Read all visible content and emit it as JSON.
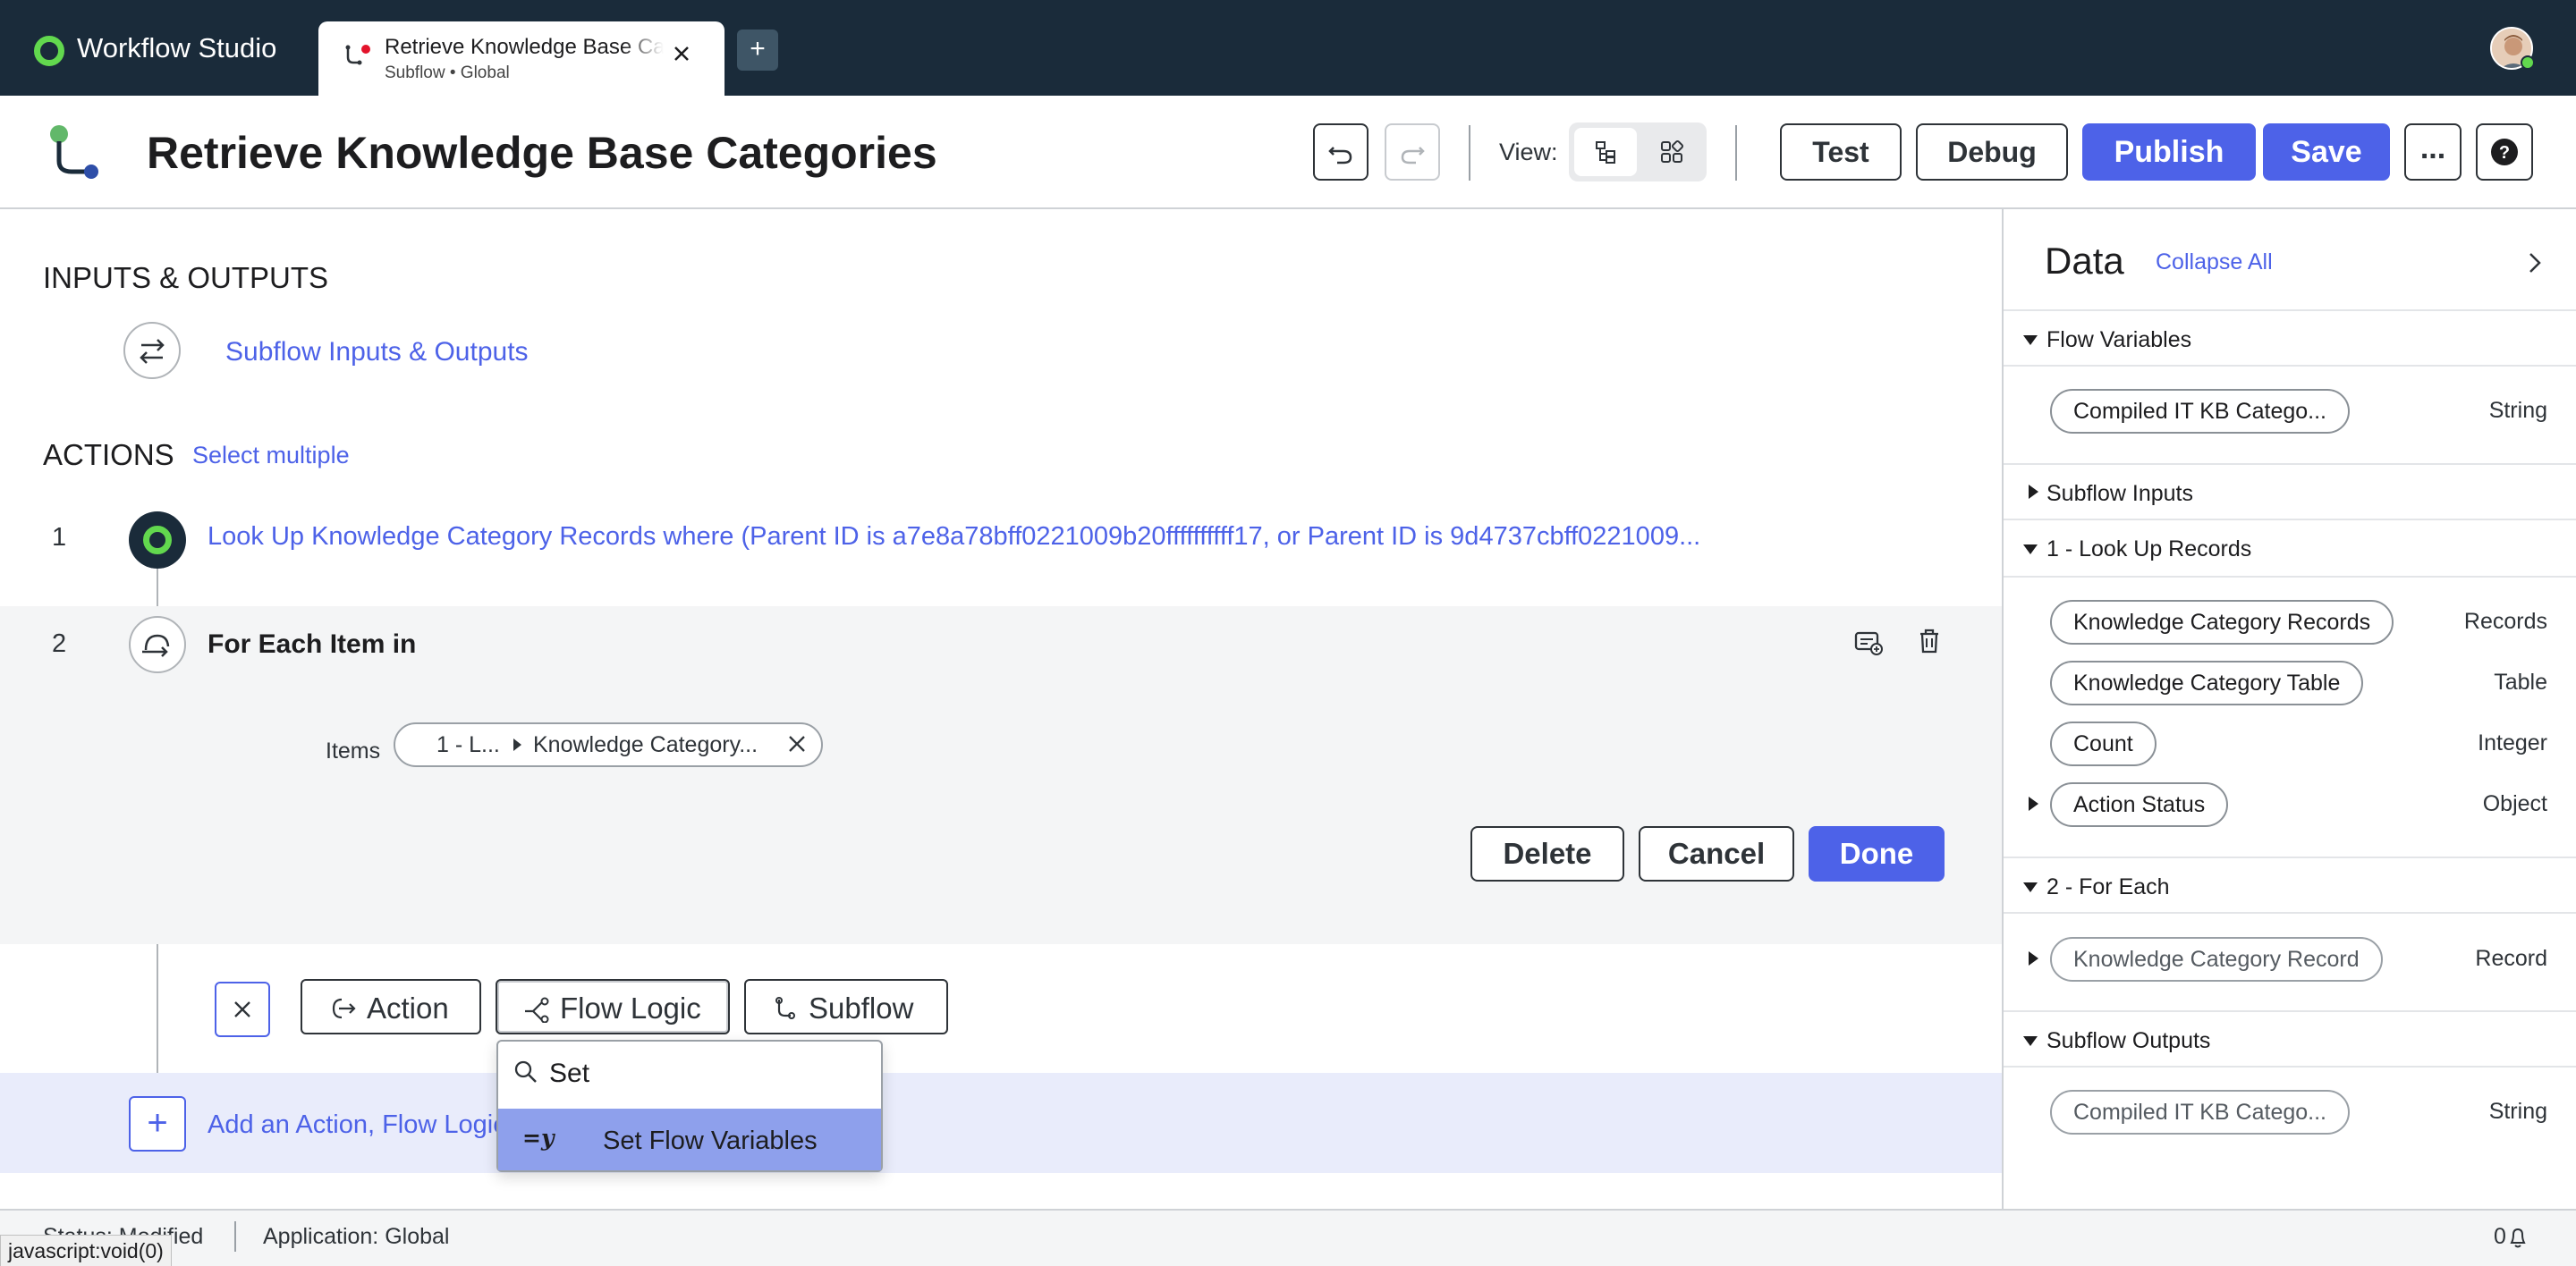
{
  "app": {
    "name": "Workflow Studio"
  },
  "tab": {
    "title": "Retrieve Knowledge Base Categories",
    "subtitle": "Subflow • Global",
    "new_tab": "+"
  },
  "header": {
    "title": "Retrieve Knowledge Base Categories",
    "view_label": "View:",
    "test": "Test",
    "debug": "Debug",
    "publish": "Publish",
    "save": "Save",
    "more": "..."
  },
  "main": {
    "io_heading": "INPUTS & OUTPUTS",
    "io_link": "Subflow Inputs & Outputs",
    "actions_heading": "ACTIONS",
    "select_multiple": "Select multiple",
    "steps": [
      {
        "num": "1",
        "text": "Look Up Knowledge Category Records where (Parent ID is a7e8a78bff0221009b20ffffffffff17, or Parent ID is 9d4737cbff0221009..."
      },
      {
        "num": "2",
        "title": "For Each Item in"
      }
    ],
    "items": {
      "label": "Items",
      "part_a": "1 - L...",
      "part_b": "Knowledge Category..."
    },
    "buttons": {
      "delete": "Delete",
      "cancel": "Cancel",
      "done": "Done"
    },
    "picker": {
      "action": "Action",
      "flow_logic": "Flow Logic",
      "subflow": "Subflow"
    },
    "add_text": "Add an Action, Flow Logic, or Subflow",
    "dropdown": {
      "search_value": "Set",
      "option_icon": "=y",
      "option_label": "Set Flow Variables"
    }
  },
  "data_panel": {
    "title": "Data",
    "collapse_all": "Collapse All",
    "sections": {
      "flow_variables": "Flow Variables",
      "subflow_inputs": "Subflow Inputs",
      "lookup": "1 - Look Up Records",
      "for_each": "2 - For Each",
      "subflow_outputs": "Subflow Outputs"
    },
    "pills": {
      "fv_name": "Compiled IT KB Catego...",
      "fv_type": "String",
      "lr_records": "Knowledge Category Records",
      "lr_records_type": "Records",
      "lr_table": "Knowledge Category Table",
      "lr_table_type": "Table",
      "lr_count": "Count",
      "lr_count_type": "Integer",
      "lr_status": "Action Status",
      "lr_status_type": "Object",
      "fe_record": "Knowledge Category Record",
      "fe_record_type": "Record",
      "so_name": "Compiled IT KB Catego...",
      "so_type": "String"
    }
  },
  "status": {
    "state": "Status: Modified",
    "application": "Application: Global",
    "count": "0",
    "url_hint": "javascript:void(0)"
  },
  "colors": {
    "accent": "#4d62e8",
    "topbar": "#1a2b3a",
    "brand_green": "#62d84e"
  }
}
